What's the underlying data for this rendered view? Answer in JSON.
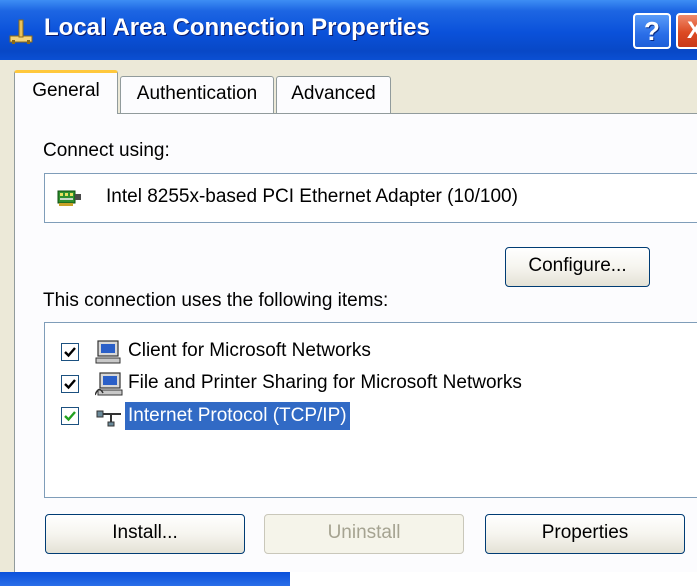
{
  "window": {
    "title": "Local Area Connection Properties",
    "help_glyph": "?",
    "close_glyph": "X"
  },
  "tabs": [
    {
      "label": "General",
      "active": true
    },
    {
      "label": "Authentication",
      "active": false
    },
    {
      "label": "Advanced",
      "active": false
    }
  ],
  "connect_using": {
    "label": "Connect using:",
    "adapter": "Intel 8255x-based PCI Ethernet Adapter (10/100)",
    "configure_label": "Configure..."
  },
  "items_section": {
    "label": "This connection uses the following items:",
    "items": [
      {
        "label": "Client for Microsoft Networks",
        "checked": true,
        "selected": false,
        "icon": "network-client-icon"
      },
      {
        "label": "File and Printer Sharing for Microsoft Networks",
        "checked": true,
        "selected": false,
        "icon": "file-printer-sharing-icon"
      },
      {
        "label": "Internet Protocol (TCP/IP)",
        "checked": true,
        "selected": true,
        "icon": "network-protocol-icon"
      }
    ]
  },
  "buttons": {
    "install": "Install...",
    "uninstall": "Uninstall",
    "properties": "Properties"
  },
  "colors": {
    "titlebar": "#0a51da",
    "dialog_face": "#ece9d8",
    "selection": "#316ac5",
    "tab_highlight": "#ffc83c"
  }
}
